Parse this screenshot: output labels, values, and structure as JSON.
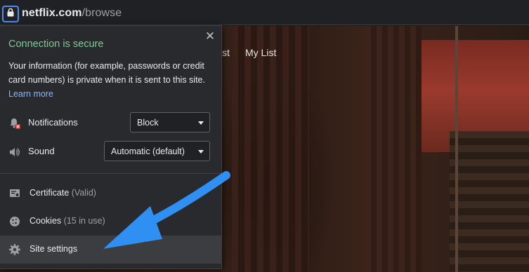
{
  "address_bar": {
    "host": "netflix.com",
    "path": "/browse",
    "lock_icon": "lock-icon"
  },
  "page": {
    "nav_fragment": "st",
    "nav_my_list": "My List"
  },
  "popup": {
    "title": "Connection is secure",
    "description": "Your information (for example, passwords or credit card numbers) is private when it is sent to this site.",
    "learn_more": "Learn more",
    "close_icon": "close-icon",
    "permissions": [
      {
        "label": "Notifications",
        "value": "Block",
        "icon": "notifications-blocked-icon"
      },
      {
        "label": "Sound",
        "value": "Automatic (default)",
        "icon": "speaker-icon"
      }
    ],
    "items": [
      {
        "label": "Certificate",
        "sub": "(Valid)",
        "icon": "certificate-icon"
      },
      {
        "label": "Cookies",
        "sub": "(15 in use)",
        "icon": "cookie-icon"
      },
      {
        "label": "Site settings",
        "sub": "",
        "icon": "gear-icon"
      }
    ]
  },
  "colors": {
    "secure_green": "#81c995",
    "link_blue": "#8ab4f8",
    "focus_blue": "#4f8df5",
    "annotation_arrow": "#2f8ff2"
  }
}
